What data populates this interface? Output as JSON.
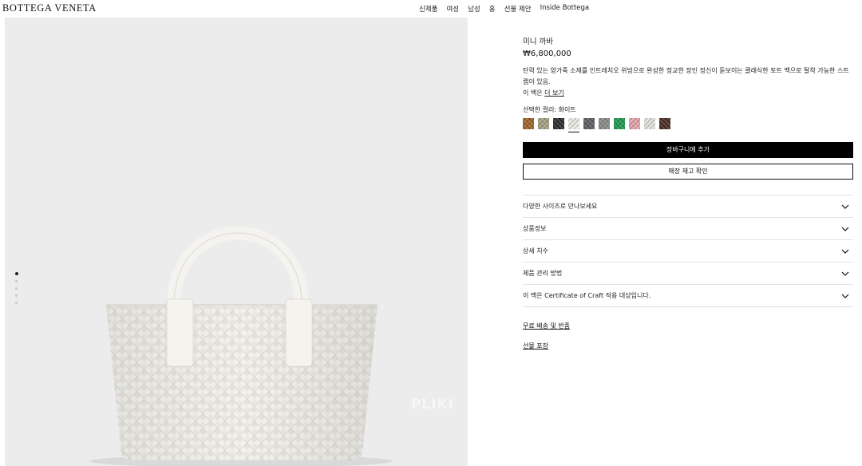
{
  "header": {
    "logo": "BOTTEGA VENETA",
    "nav": [
      "신제품",
      "여성",
      "남성",
      "홈",
      "선물 제안",
      "Inside Bottega"
    ]
  },
  "gallery": {
    "dots": [
      true,
      false,
      false,
      false,
      false
    ],
    "watermark": "PLIKI"
  },
  "product": {
    "title": "미니 까바",
    "price": "₩6,800,000",
    "description": "탄력 있는 양가죽 소재를 인트레치오 위빙으로 완성한 정교한 장인 정신이 돋보이는 클래식한 토트 백으로 탈착 가능한 스트랩이 있음.",
    "more_prefix": "이 백은 ",
    "more_link": "더 보기",
    "color_label": "선택한 컬러: 화이트",
    "swatches": [
      {
        "name": "caramel",
        "color": "#a0622a",
        "selected": false
      },
      {
        "name": "travertine",
        "color": "#a9a286",
        "selected": false
      },
      {
        "name": "black",
        "color": "#2a2a2a",
        "selected": false
      },
      {
        "name": "white",
        "color": "#efefe8",
        "selected": true
      },
      {
        "name": "thunder",
        "color": "#5b5e63",
        "selected": false
      },
      {
        "name": "grey",
        "color": "#8a8c88",
        "selected": false
      },
      {
        "name": "green",
        "color": "#1d9a4e",
        "selected": false
      },
      {
        "name": "pink",
        "color": "#e8a4ad",
        "selected": false
      },
      {
        "name": "off-white",
        "color": "#e3e6df",
        "selected": false
      },
      {
        "name": "brown",
        "color": "#4a2a20",
        "selected": false
      }
    ],
    "add_to_cart": "장바구니에 추가",
    "check_stock": "매장 재고 확인",
    "accordion": [
      "다양한 사이즈로 만나보세요",
      "상품정보",
      "상세 치수",
      "제품 관리 방법",
      "이 백은 Certificate of Craft 적용 대상입니다."
    ],
    "links": [
      "무료 배송 및 반품",
      "선물 포장"
    ]
  }
}
